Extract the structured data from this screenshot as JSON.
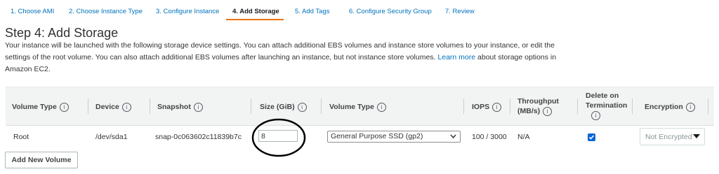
{
  "wizard": {
    "tabs": [
      {
        "label": "1. Choose AMI"
      },
      {
        "label": "2. Choose Instance Type"
      },
      {
        "label": "3. Configure Instance"
      },
      {
        "label": "4. Add Storage"
      },
      {
        "label": "5. Add Tags"
      },
      {
        "label": "6. Configure Security Group"
      },
      {
        "label": "7. Review"
      }
    ],
    "active_tab": "4. Add Storage"
  },
  "page": {
    "title": "Step 4: Add Storage",
    "description_1": "Your instance will be launched with the following storage device settings. You can attach additional EBS volumes and instance store volumes to your instance, or edit the settings of the root volume. You can also attach additional EBS volumes after launching an instance, but not instance store volumes.",
    "learn_more": "Learn more",
    "description_2": "about storage options in Amazon EC2."
  },
  "table": {
    "headers": {
      "volume_type": "Volume Type",
      "device": "Device",
      "snapshot": "Snapshot",
      "size": "Size (GiB)",
      "volume_type_2": "Volume Type",
      "iops": "IOPS",
      "throughput_1": "Throughput",
      "throughput_2": "(MB/s)",
      "delete_1": "Delete on",
      "delete_2": "Termination",
      "encryption": "Encryption"
    },
    "info_glyph": "i",
    "row": {
      "volume_type": "Root",
      "device": "/dev/sda1",
      "snapshot": "snap-0c063602c11839b7c",
      "size": "8",
      "ebs_volume_type": "General Purpose SSD (gp2)",
      "iops": "100 / 3000",
      "throughput": "N/A",
      "delete_on_termination": true,
      "encryption": "Not Encrypted"
    }
  },
  "actions": {
    "add_new_volume": "Add New Volume"
  },
  "colors": {
    "link": "#0073bb",
    "active_tab_underline": "#ec7211",
    "checkbox": "#0a66d6",
    "header_bg": "#f2f3f3"
  },
  "icons": [
    "info-icon",
    "chevron-down-icon",
    "caret-down-icon",
    "check-icon"
  ]
}
